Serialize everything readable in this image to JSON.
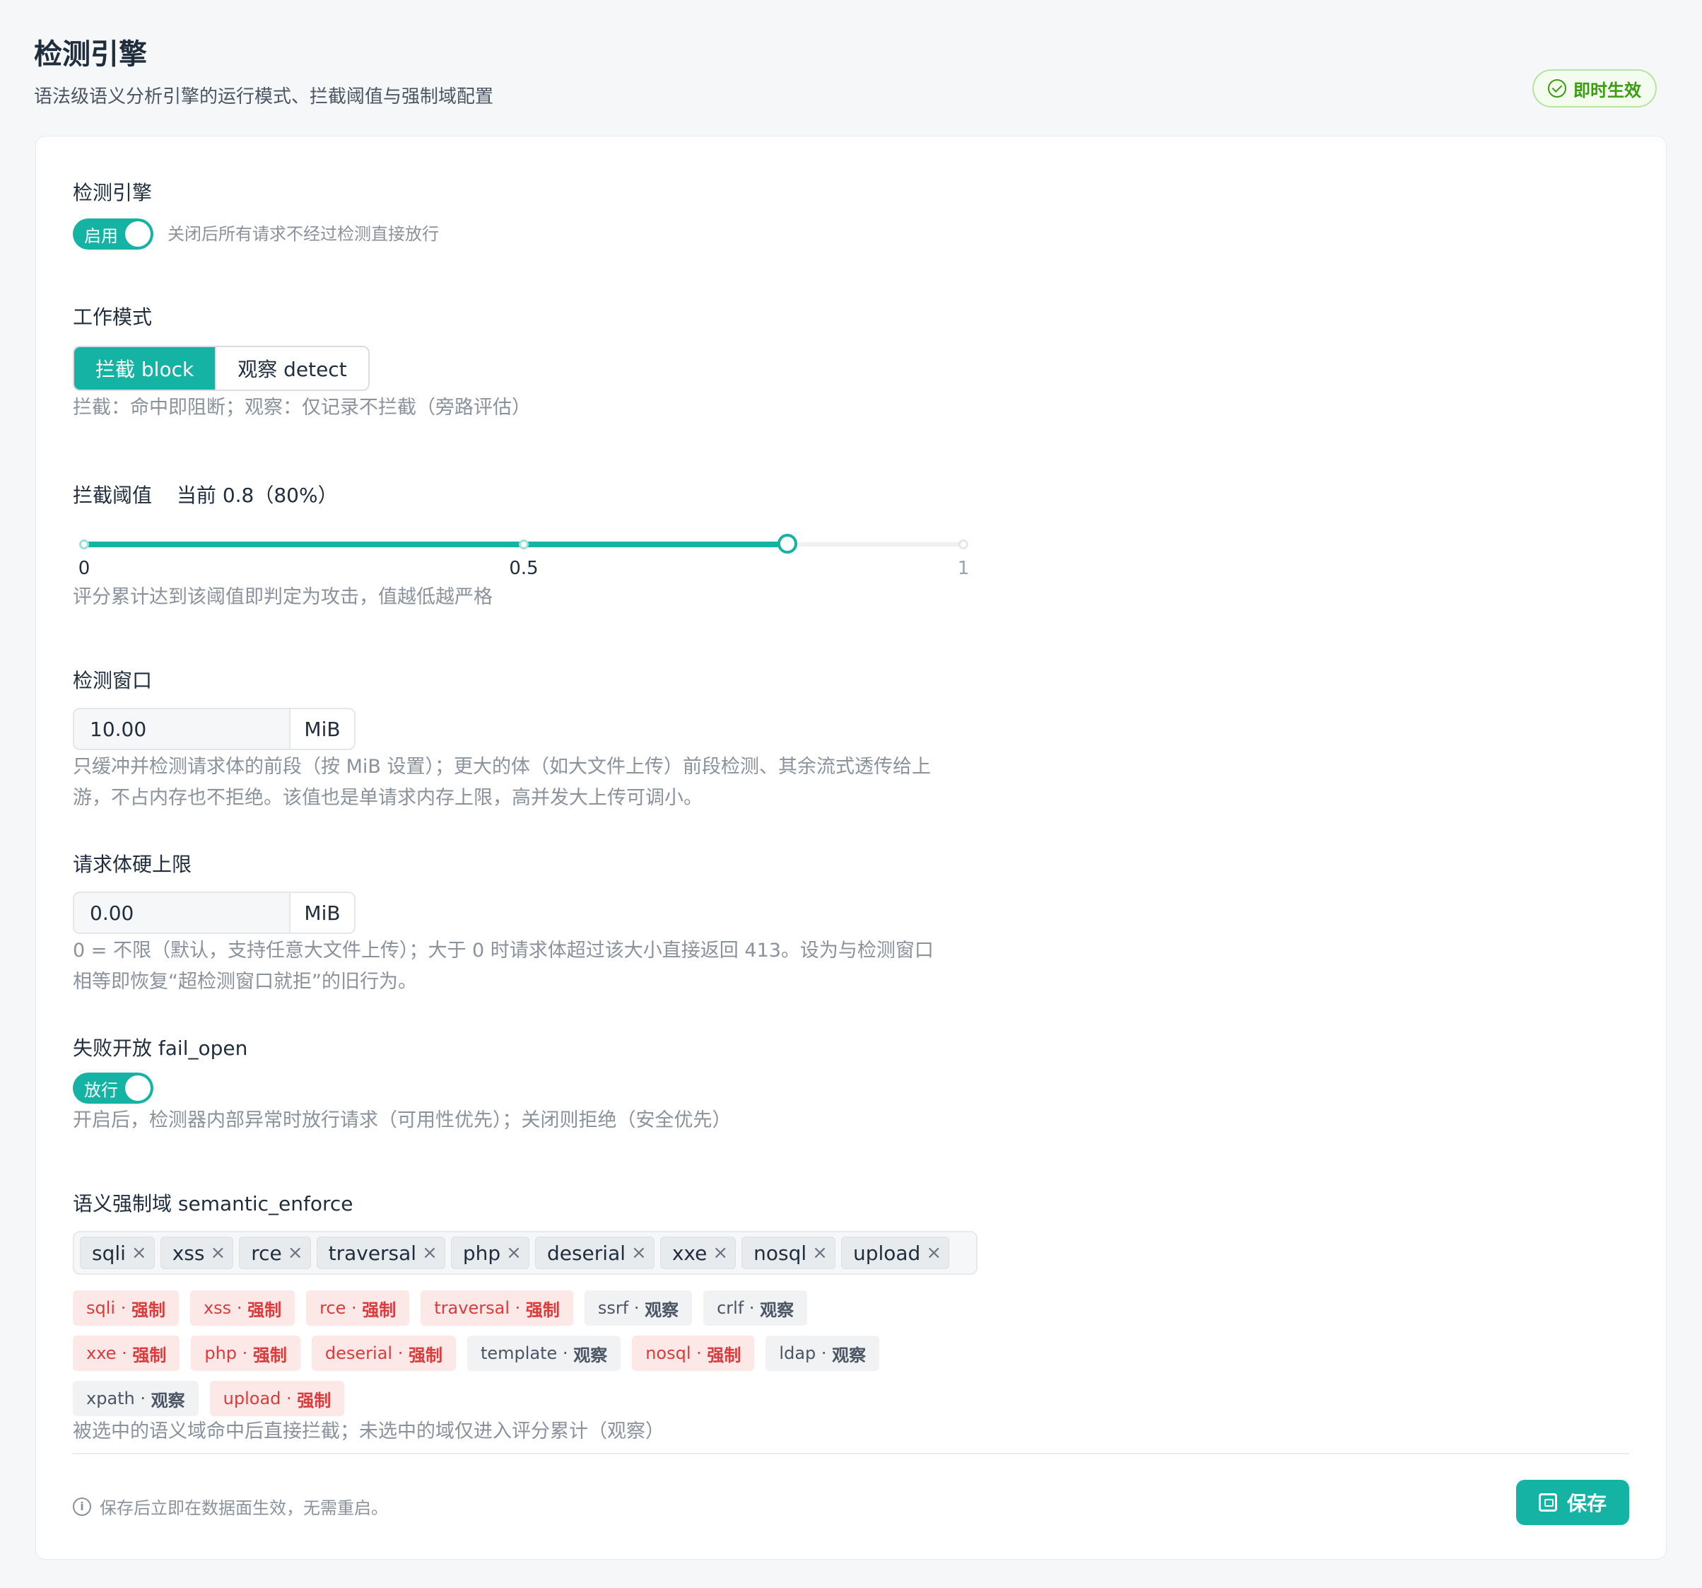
{
  "header": {
    "title": "检测引擎",
    "subtitle": "语法级语义分析引擎的运行模式、拦截阈值与强制域配置",
    "live_badge": "即时生效"
  },
  "engine": {
    "label": "检测引擎",
    "switch_text": "启用",
    "enabled": true,
    "hint": "关闭后所有请求不经过检测直接放行"
  },
  "mode": {
    "label": "工作模式",
    "options": [
      "拦截 block",
      "观察 detect"
    ],
    "selected": "拦截 block",
    "help": "拦截：命中即阻断；观察：仅记录不拦截（旁路评估）"
  },
  "threshold": {
    "label": "拦截阈值",
    "current": "当前 0.8（80%）",
    "value": 0.8,
    "min": 0,
    "max": 1,
    "marks": [
      "0",
      "0.5",
      "1"
    ],
    "help": "评分累计达到该阈值即判定为攻击，值越低越严格"
  },
  "window": {
    "label": "检测窗口",
    "value": "10.00",
    "unit": "MiB",
    "help_line1": "只缓冲并检测请求体的前段（按 MiB 设置）；更大的体（如大文件上传）前段检测、其余流式透传给上",
    "help_line2": "游，不占内存也不拒绝。该值也是单请求内存上限，高并发大上传可调小。"
  },
  "body_limit": {
    "label": "请求体硬上限",
    "value": "0.00",
    "unit": "MiB",
    "help_line1": "0 = 不限（默认，支持任意大文件上传）；大于 0 时请求体超过该大小直接返回 413。设为与检测窗口",
    "help_line2": "相等即恢复“超检测窗口就拒”的旧行为。"
  },
  "fail_open": {
    "label": "失败开放 fail_open",
    "switch_text": "放行",
    "enabled": true,
    "help": "开启后，检测器内部异常时放行请求（可用性优先）；关闭则拒绝（安全优先）"
  },
  "semantic_enforce": {
    "label": "语义强制域 semantic_enforce",
    "selected": [
      "sqli",
      "xss",
      "rce",
      "traversal",
      "php",
      "deserial",
      "xxe",
      "nosql",
      "upload"
    ],
    "domains": [
      {
        "name": "sqli",
        "state": "强制",
        "enforced": true
      },
      {
        "name": "xss",
        "state": "强制",
        "enforced": true
      },
      {
        "name": "rce",
        "state": "强制",
        "enforced": true
      },
      {
        "name": "traversal",
        "state": "强制",
        "enforced": true
      },
      {
        "name": "ssrf",
        "state": "观察",
        "enforced": false
      },
      {
        "name": "crlf",
        "state": "观察",
        "enforced": false
      },
      {
        "name": "xxe",
        "state": "强制",
        "enforced": true
      },
      {
        "name": "php",
        "state": "强制",
        "enforced": true
      },
      {
        "name": "deserial",
        "state": "强制",
        "enforced": true
      },
      {
        "name": "template",
        "state": "观察",
        "enforced": false
      },
      {
        "name": "nosql",
        "state": "强制",
        "enforced": true
      },
      {
        "name": "ldap",
        "state": "观察",
        "enforced": false
      },
      {
        "name": "xpath",
        "state": "观察",
        "enforced": false
      },
      {
        "name": "upload",
        "state": "强制",
        "enforced": true
      }
    ],
    "help": "被选中的语义域命中后直接拦截；未选中的域仅进入评分累计（观察）"
  },
  "footer": {
    "note": "保存后立即在数据面生效，无需重启。",
    "save_label": "保存"
  },
  "colors": {
    "accent": "#14b3a3",
    "enforce_bg": "#fde8e8",
    "enforce_text": "#dc3b3b",
    "observe_bg": "#f0f2f4",
    "live_green": "#389e0d"
  },
  "icons": {
    "live_badge": "check-circle-icon",
    "info": "info-icon",
    "save": "save-icon",
    "chip_remove": "close-icon"
  }
}
